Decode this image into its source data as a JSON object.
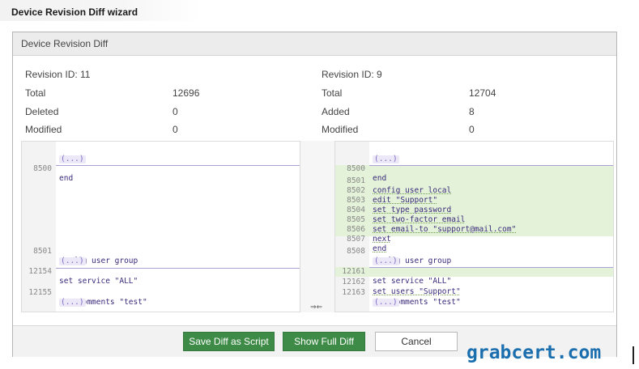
{
  "window": {
    "title": "Device Revision Diff wizard"
  },
  "dialog": {
    "header": "Device Revision Diff"
  },
  "left_summary": {
    "revision": "Revision ID: 11",
    "rows": [
      {
        "label": "Total",
        "value": "12696"
      },
      {
        "label": "Deleted",
        "value": "0"
      },
      {
        "label": "Modified",
        "value": "0"
      }
    ]
  },
  "right_summary": {
    "revision": "Revision ID: 9",
    "rows": [
      {
        "label": "Total",
        "value": "12704"
      },
      {
        "label": "Added",
        "value": "8"
      },
      {
        "label": "Modified",
        "value": "0"
      }
    ]
  },
  "collapsed_marker": "(...)",
  "left_lines": {
    "l8500": {
      "num": "8500",
      "code": "end"
    },
    "l8501": {
      "num": "8501",
      "code": "config user group"
    },
    "l12154": {
      "num": "12154",
      "code": "set service \"ALL\""
    },
    "l12155": {
      "num": "12155",
      "code": "set comments \"test\""
    }
  },
  "right_lines": {
    "r8500": {
      "num": "8500",
      "code": "end"
    },
    "r8501": {
      "num": "8501",
      "code": "config user local"
    },
    "r8502": {
      "num": "8502",
      "code": "edit \"Support\""
    },
    "r8503": {
      "num": "8503",
      "code": "set type password"
    },
    "r8504": {
      "num": "8504",
      "code": "set two-factor email"
    },
    "r8505": {
      "num": "8505",
      "code": "set email-to \"support@mail.com\""
    },
    "r8506": {
      "num": "8506",
      "code": "next"
    },
    "r8507": {
      "num": "8507",
      "code": "end"
    },
    "r8508": {
      "num": "8508",
      "code": "config user group"
    },
    "r12161": {
      "num": "12161",
      "code": "set service \"ALL\""
    },
    "r12162": {
      "num": "12162",
      "code": "set users \"Support\""
    },
    "r12163": {
      "num": "12163",
      "code": "set comments \"test\""
    }
  },
  "gutter_arrows": "⇒⇐",
  "buttons": {
    "save_diff": "Save Diff as Script",
    "show_full": "Show Full Diff",
    "cancel": "Cancel"
  },
  "watermark": "grabcert.com",
  "colors": {
    "button_green": "#3e8b47",
    "added_background": "#e3f2d8",
    "code_text": "#3a2a7a",
    "watermark": "#1b6fae"
  }
}
